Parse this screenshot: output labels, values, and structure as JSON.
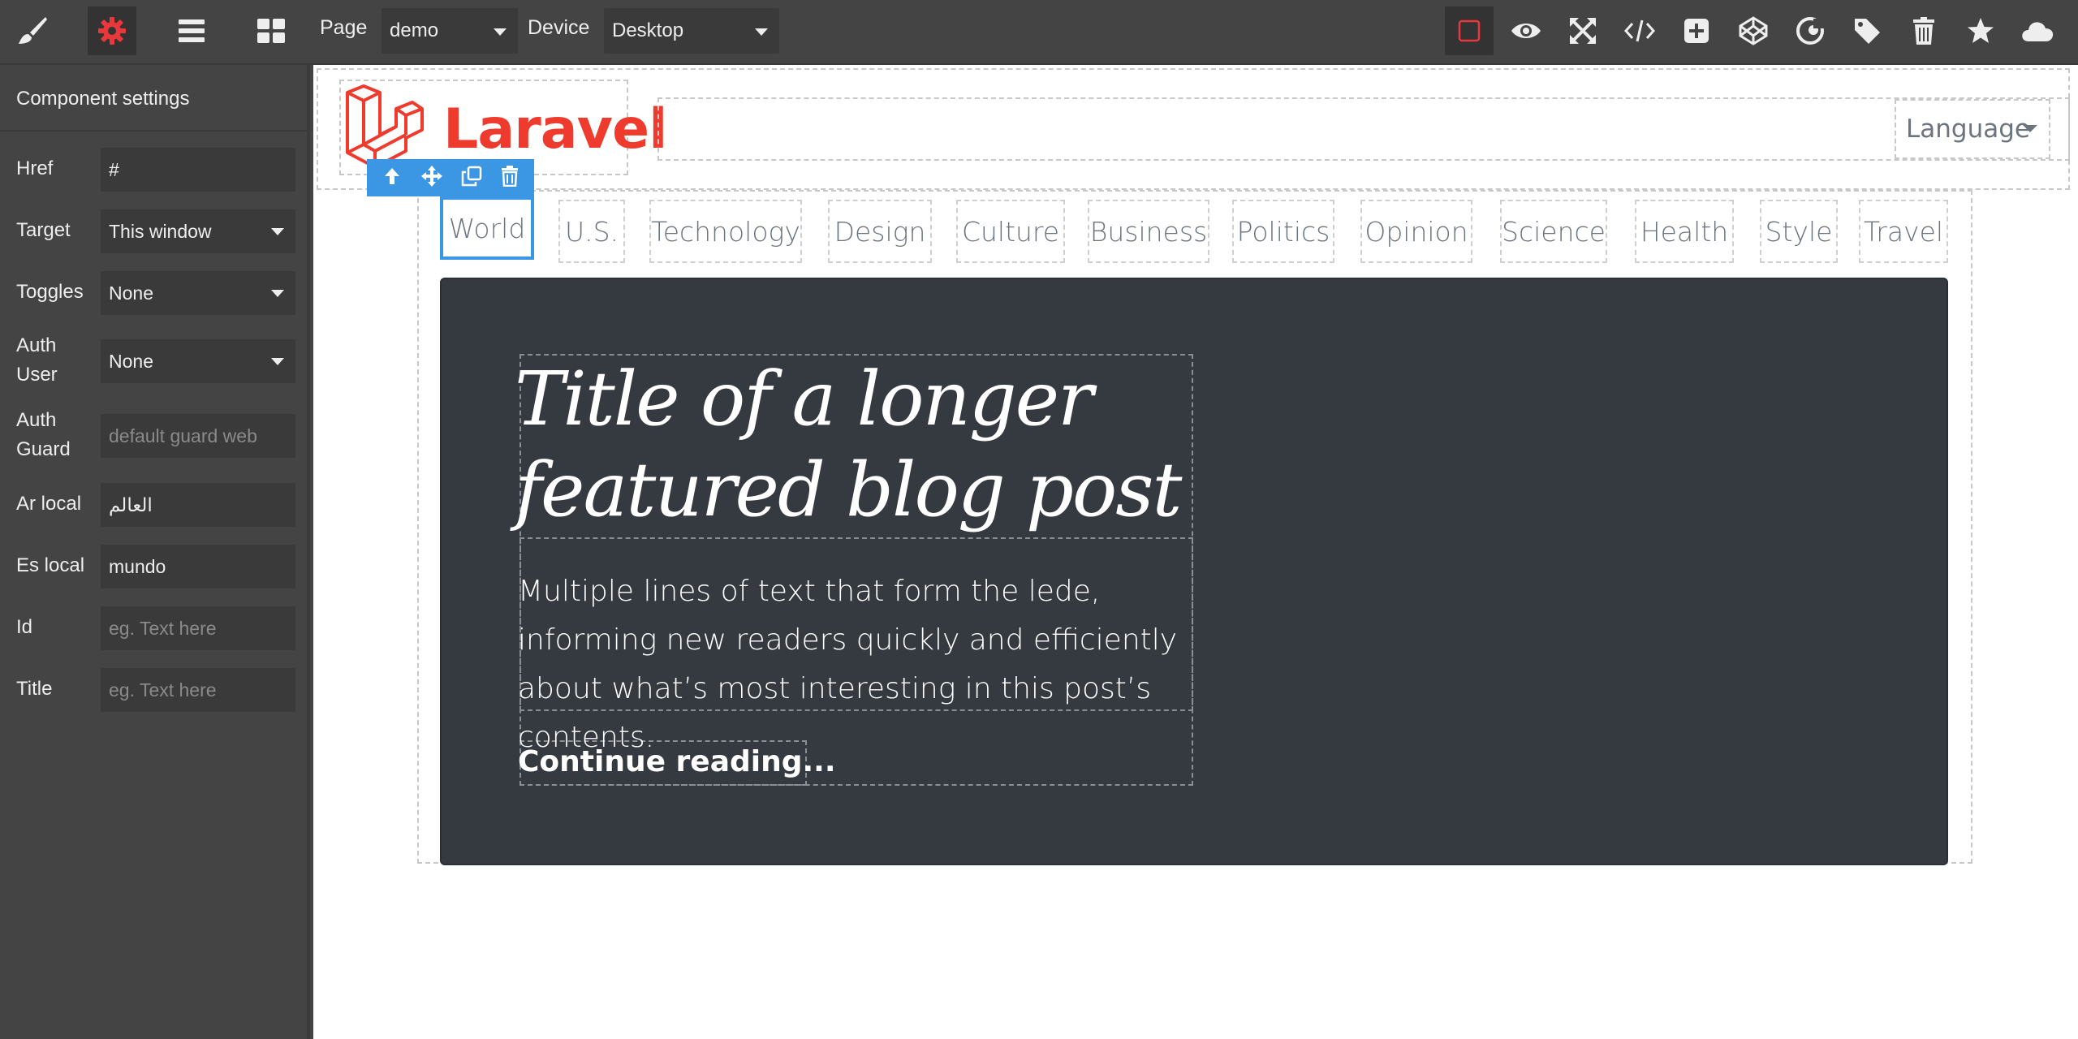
{
  "toolbar": {
    "page_label": "Page",
    "page_value": "demo",
    "device_label": "Device",
    "device_value": "Desktop",
    "left_icons": [
      "brush-icon",
      "gear-icon",
      "layers-icon",
      "blocks-icon"
    ],
    "right_icons": [
      "outline-icon",
      "eye-icon",
      "fullscreen-icon",
      "code-icon",
      "add-icon",
      "codepen-icon",
      "grapes-icon",
      "tag-icon",
      "trash-icon",
      "star-icon",
      "cloud-icon"
    ],
    "accent_color": "#e8383b"
  },
  "panel": {
    "title": "Component settings",
    "fields": [
      {
        "label": "Href",
        "value": "#",
        "type": "input"
      },
      {
        "label": "Target",
        "value": "This window",
        "type": "select"
      },
      {
        "label": "Toggles",
        "value": "None",
        "type": "select"
      },
      {
        "label": "Auth User",
        "value": "None",
        "type": "select"
      },
      {
        "label": "Auth Guard",
        "placeholder": "default guard web",
        "type": "input"
      },
      {
        "label": "Ar local",
        "value": "العالم",
        "type": "input"
      },
      {
        "label": "Es local",
        "value": "mundo",
        "type": "input"
      },
      {
        "label": "Id",
        "placeholder": "eg. Text here",
        "type": "input"
      },
      {
        "label": "Title",
        "placeholder": "eg. Text here",
        "type": "input"
      }
    ]
  },
  "site": {
    "logo_text": "Laravel",
    "logo_color": "#ef3b2d",
    "language_label": "Language",
    "nav": [
      "World",
      "U.S.",
      "Technology",
      "Design",
      "Culture",
      "Business",
      "Politics",
      "Opinion",
      "Science",
      "Health",
      "Style",
      "Travel"
    ],
    "hero_title": "Title of a longer featured blog post",
    "hero_lede": "Multiple lines of text that form the lede, informing new readers quickly and efficiently about what’s most interesting in this post’s contents.",
    "hero_link": "Continue reading..."
  },
  "selection": {
    "color": "#3b97e3",
    "tools": [
      "arrow-up-icon",
      "move-icon",
      "clone-icon",
      "delete-icon"
    ]
  }
}
